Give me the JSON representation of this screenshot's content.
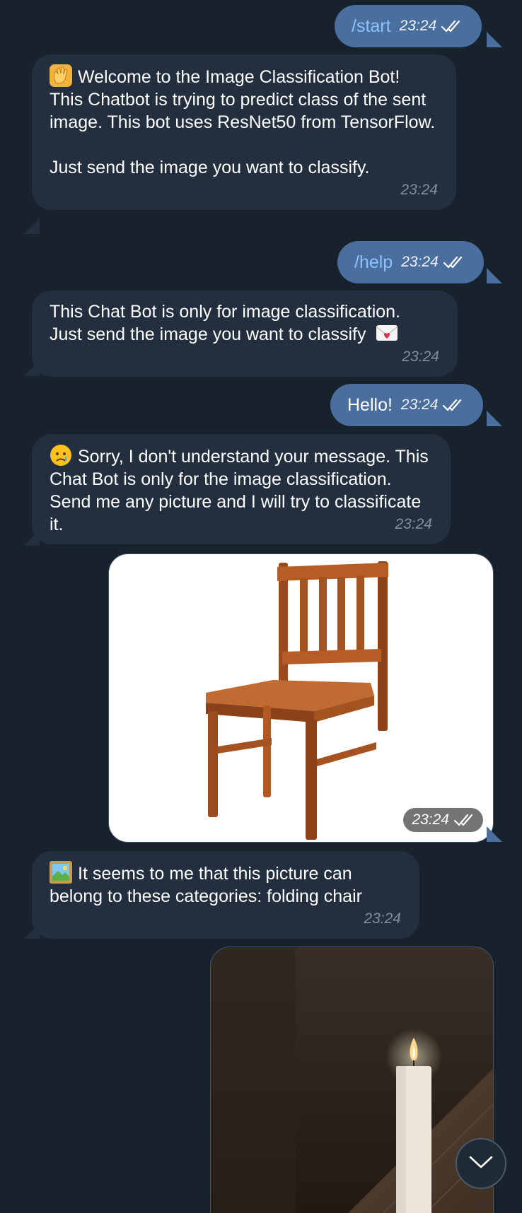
{
  "colors": {
    "background": "#18222d",
    "incoming_bubble": "#232f3e",
    "outgoing_bubble": "#4a6e9e",
    "command_text": "#8cc3ff",
    "incoming_time": "#8a97a6"
  },
  "messages": [
    {
      "direction": "out",
      "text": "/start",
      "is_command": true,
      "time": "23:24",
      "status": "read",
      "status_icon": "double-check-icon"
    },
    {
      "direction": "in",
      "emoji": "waving-hand",
      "text": "Welcome to the Image Classification Bot!\nThis Chatbot is trying to predict class of the sent image. This bot uses ResNet50 from TensorFlow.\n\nJust send the image you want to classify.",
      "time": "23:24"
    },
    {
      "direction": "out",
      "text": "/help",
      "is_command": true,
      "time": "23:24",
      "status": "read",
      "status_icon": "double-check-icon"
    },
    {
      "direction": "in",
      "text": "This Chat Bot is only for image classification.\nJust send the image you want to classify",
      "trailing_emoji": "love-letter",
      "time": "23:24"
    },
    {
      "direction": "out",
      "text": "Hello!",
      "is_command": false,
      "time": "23:24",
      "status": "read",
      "status_icon": "double-check-icon"
    },
    {
      "direction": "in",
      "emoji": "crying-face",
      "text": "Sorry, I don't understand your message. This Chat Bot is only for the image classification. Send me any picture and I will try to classificate it.",
      "time": "23:24"
    },
    {
      "direction": "out",
      "type": "photo",
      "subject": "wooden-chair",
      "time": "23:24",
      "status": "read",
      "status_icon": "double-check-icon"
    },
    {
      "direction": "in",
      "emoji": "framed-picture",
      "text": "It seems to me that this picture can belong to these categories: folding chair",
      "time": "23:24"
    },
    {
      "direction": "out",
      "type": "photo",
      "subject": "candle"
    }
  ],
  "scroll_button": {
    "icon": "chevron-down-icon"
  }
}
